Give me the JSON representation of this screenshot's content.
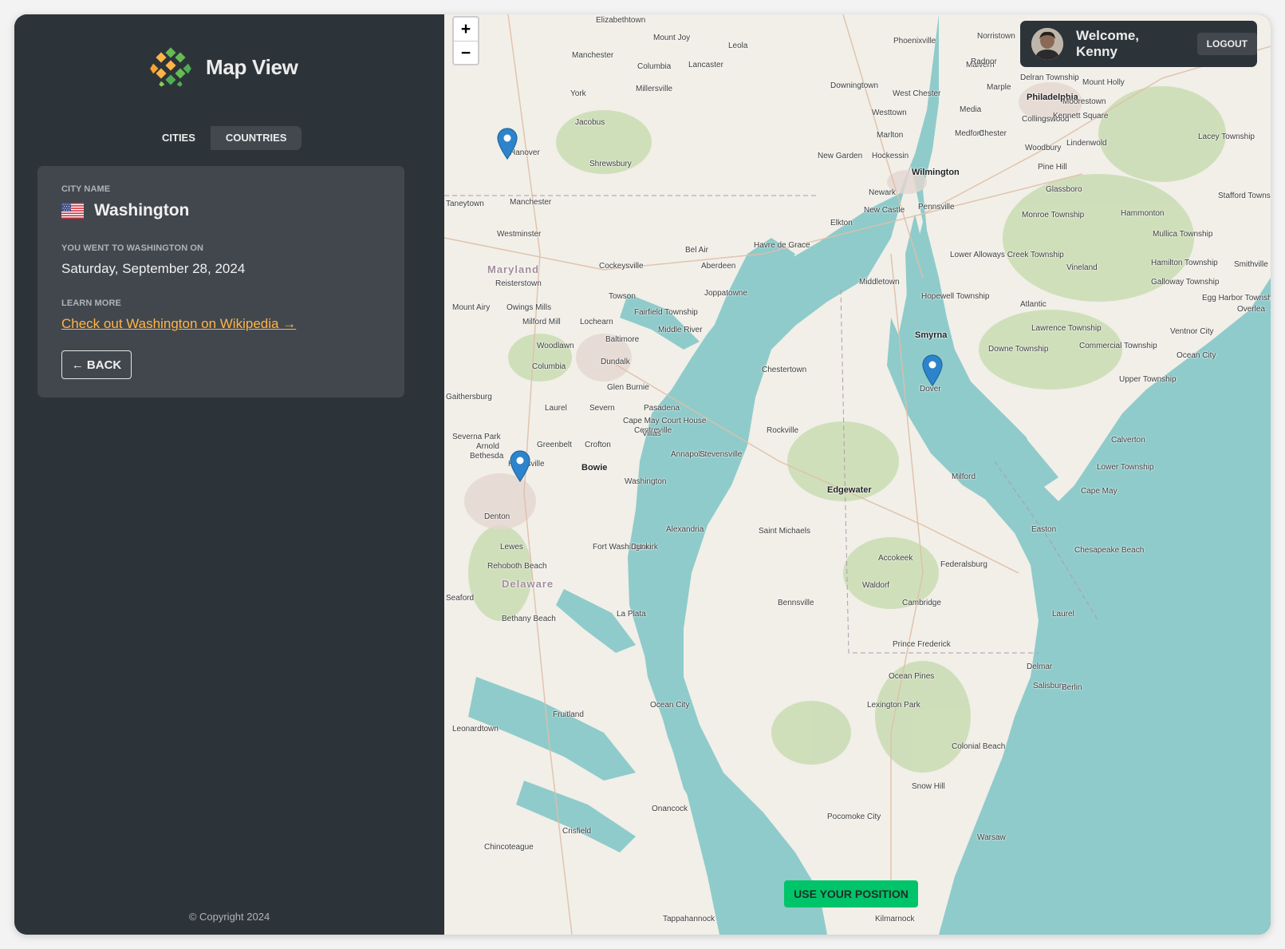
{
  "app": {
    "title": "Map View",
    "copyright": "© Copyright 2024"
  },
  "tabs": [
    {
      "label": "CITIES",
      "active": true
    },
    {
      "label": "COUNTRIES",
      "active": false
    }
  ],
  "city": {
    "name_label": "CITY NAME",
    "flag": "us-flag-icon",
    "name": "Washington",
    "visit_label": "YOU WENT TO WASHINGTON ON",
    "visit_date": "Saturday, September 28, 2024",
    "learn_label": "LEARN MORE",
    "wiki_link": "Check out Washington on Wikipedia →",
    "back_button": "← BACK"
  },
  "user": {
    "welcome": "Welcome, Kenny",
    "logout": "LOGOUT"
  },
  "map": {
    "zoom_in": "+",
    "zoom_out": "−",
    "use_position": "USE YOUR POSITION",
    "markers": [
      "Hanover",
      "Washington",
      "Dover"
    ],
    "labels": [
      "Elizabethtown",
      "Mount Joy",
      "Leola",
      "Phoenixville",
      "Norristown",
      "Manchester",
      "Columbia",
      "Lancaster",
      "Malvern",
      "Radnor",
      "Millersville",
      "Downingtown",
      "West Chester",
      "Marple",
      "Delran Township",
      "Philadelphia",
      "Moorestown",
      "Mount Holly",
      "York",
      "Westtown",
      "Media",
      "Collingswood",
      "Jacobus",
      "Marlton",
      "Medford",
      "Kennett Square",
      "Chester",
      "Lindenwold",
      "Woodbury",
      "Lacey Township",
      "Hanover",
      "New Garden",
      "Hockessin",
      "Wilmington",
      "Pine Hill",
      "Shrewsbury",
      "Glassboro",
      "Newark",
      "Stafford Township",
      "Taneytown",
      "Manchester",
      "New Castle",
      "Pennsville",
      "Monroe Township",
      "Hammonton",
      "Westminster",
      "Elkton",
      "Mullica Township",
      "Bel Air",
      "Havre de Grace",
      "Lower Alloways Creek Township",
      "Maryland",
      "Cockeysville",
      "Aberdeen",
      "Hamilton Township",
      "Vineland",
      "Smithville",
      "Reisterstown",
      "Middletown",
      "Galloway Township",
      "Joppatowne",
      "Hopewell Township",
      "Egg Harbor Township",
      "Mount Airy",
      "Owings Mills",
      "Towson",
      "Fairfield Township",
      "Atlantic",
      "Overlea",
      "Milford Mill",
      "Lochearn",
      "Middle River",
      "Lawrence Township",
      "Ventnor City",
      "Baltimore",
      "Smyrna",
      "Woodlawn",
      "Commercial Township",
      "Downe Township",
      "Ocean City",
      "Dundalk",
      "Columbia",
      "Chestertown",
      "Upper Township",
      "Glen Burnie",
      "Dover",
      "Gaithersburg",
      "Laurel",
      "Severn",
      "Pasadena",
      "Cape May Court House",
      "Rockville",
      "Severna Park",
      "Centreville",
      "Calverton",
      "Arnold",
      "Villas",
      "Greenbelt",
      "Crofton",
      "Bethesda",
      "Annapolis",
      "Stevensville",
      "Lower Township",
      "Hyattsville",
      "Bowie",
      "Milford",
      "Washington",
      "Edgewater",
      "Cape May",
      "Denton",
      "Alexandria",
      "Saint Michaels",
      "Easton",
      "Lewes",
      "Fort Washington",
      "Dunkirk",
      "Chesapeake Beach",
      "Rehoboth Beach",
      "Accokeek",
      "Federalsburg",
      "Delaware",
      "Waldorf",
      "Seaford",
      "Bennsville",
      "Cambridge",
      "Laurel",
      "Bethany Beach",
      "La Plata",
      "Prince Frederick",
      "Delmar",
      "Ocean Pines",
      "Salisbury",
      "Berlin",
      "Ocean City",
      "Lexington Park",
      "Fruitland",
      "Leonardtown",
      "Colonial Beach",
      "Snow Hill",
      "Pocomoke City",
      "Crisfield",
      "Warsaw",
      "Chincoteague",
      "Tappahannock",
      "Kilmarnock",
      "Onancock"
    ]
  },
  "colors": {
    "sidebar": "#2d3439",
    "card": "#42474e",
    "accent": "#ffb545",
    "go": "#00c46a",
    "water": "#8fcbcb",
    "land": "#f1efe8"
  }
}
